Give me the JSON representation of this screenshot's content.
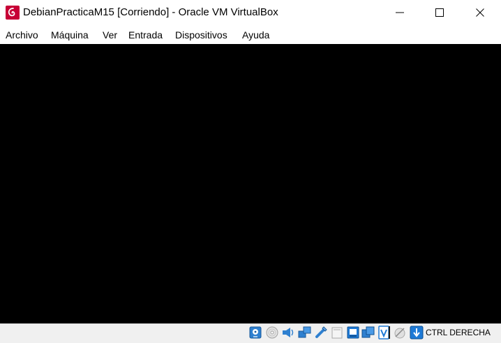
{
  "window": {
    "title": "DebianPracticaM15 [Corriendo] - Oracle VM VirtualBox",
    "app_icon": "debian-swirl-icon",
    "controls": [
      "minimize-icon",
      "maximize-icon",
      "close-icon"
    ]
  },
  "menu": {
    "items": [
      {
        "label": "Archivo"
      },
      {
        "label": "Máquina"
      },
      {
        "label": "Ver"
      },
      {
        "label": "Entrada"
      },
      {
        "label": "Dispositivos"
      },
      {
        "label": "Ayuda"
      }
    ]
  },
  "vm_screen": {
    "background": "#000000"
  },
  "status_bar": {
    "icons": [
      "hard-disk-icon",
      "optical-drive-icon",
      "audio-icon",
      "network-icon",
      "usb-icon",
      "shared-folders-icon",
      "display-icon",
      "video-capture-icon",
      "cpu-icon",
      "mouse-integration-icon",
      "keyboard-capture-icon"
    ],
    "host_key": "CTRL DERECHA"
  },
  "colors": {
    "debian_red": "#c70036",
    "statusbar_bg": "#f0f0f0",
    "icon_blue": "#1e7ad6"
  }
}
